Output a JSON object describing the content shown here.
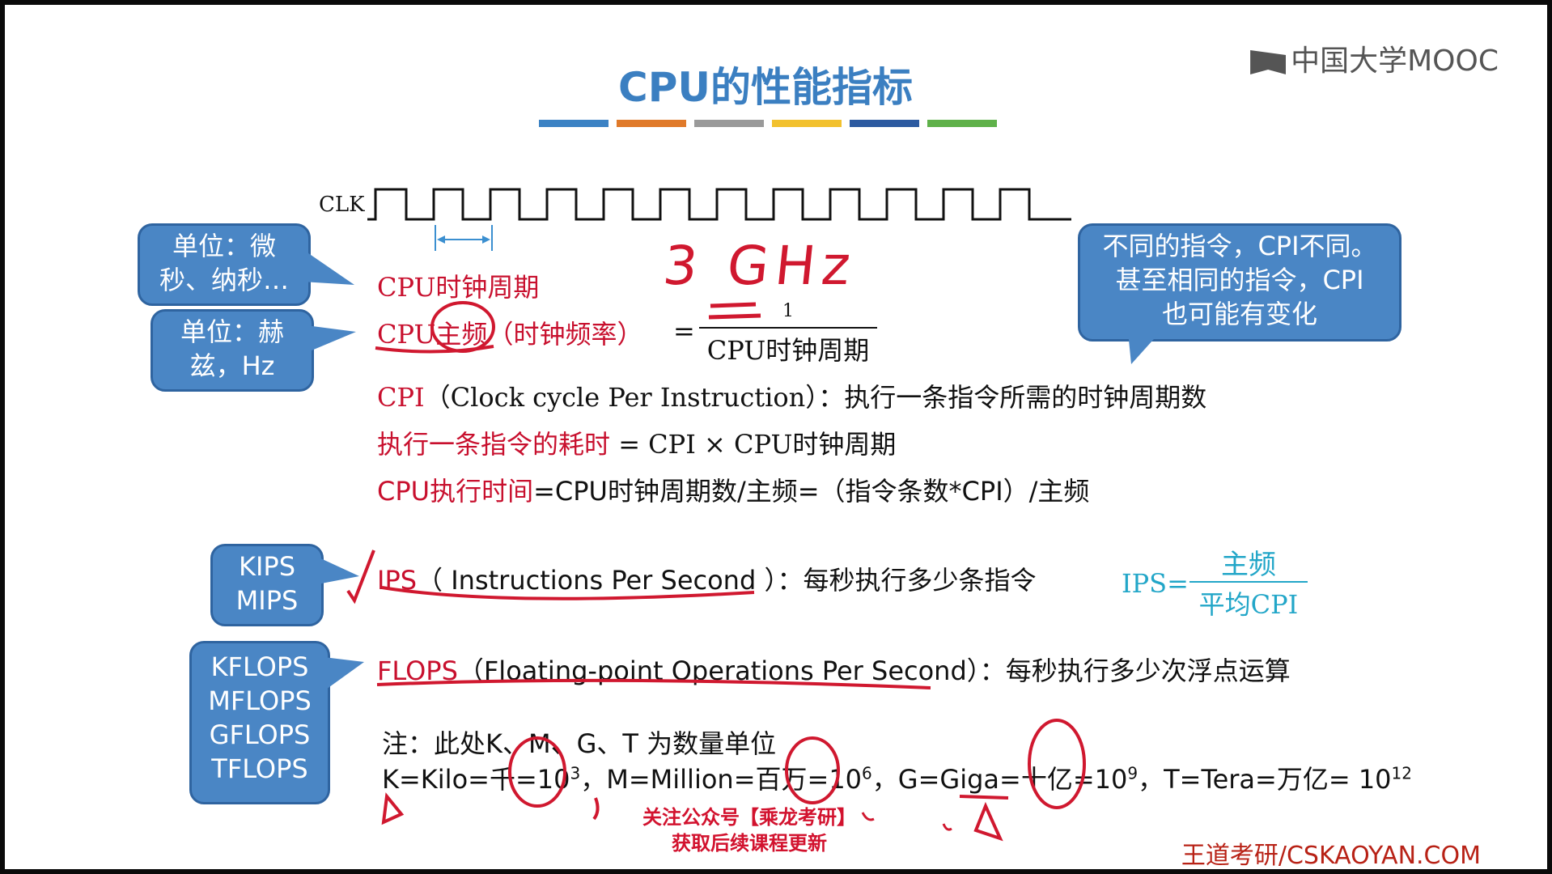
{
  "slide": {
    "title": "CPU的性能指标",
    "logo_text": "中国大学MOOC",
    "color_bars": [
      "#3b82c4",
      "#e07a2a",
      "#9a9a9a",
      "#f2c12e",
      "#2c5aa0",
      "#5fb14a"
    ],
    "clk_label": "CLK",
    "handwritten_freq": "3 GHz",
    "bubbles": {
      "unit_time": [
        "单位：微",
        "秒、纳秒…"
      ],
      "unit_freq": [
        "单位：赫",
        "兹，Hz"
      ],
      "cpi_note": [
        "不同的指令，CPI不同。",
        "甚至相同的指令，CPI",
        "也可能有变化"
      ],
      "ips_units": [
        "KIPS",
        "MIPS"
      ],
      "flops_units": [
        "KFLOPS",
        "MFLOPS",
        "GFLOPS",
        "TFLOPS"
      ]
    },
    "clock_period": "CPU时钟周期",
    "main_freq": {
      "label_red": "CPU主频",
      "label_paren": "（时钟频率）",
      "eq": "=",
      "numerator": "1",
      "denominator": "CPU时钟周期"
    },
    "cpi": {
      "label": "CPI",
      "rest": "（Clock cycle Per Instruction）：执行一条指令所需的时钟周期数"
    },
    "exec_one": {
      "label": "执行一条指令的耗时",
      "rest": " = CPI × CPU时钟周期"
    },
    "exec_time": {
      "label": "CPU执行时间",
      "rest": "=CPU时钟周期数/主频=（指令条数*CPI）/主频"
    },
    "ips": {
      "label": "IPS",
      "rest": "（ Instructions Per Second ）：每秒执行多少条指令",
      "formula_left": "IPS=",
      "formula_num": "主频",
      "formula_den": "平均CPI"
    },
    "flops": {
      "label": "FLOPS",
      "rest": "（Floating-point Operations Per Second）：每秒执行多少次浮点运算"
    },
    "note": {
      "line1": "注：此处K、M、G、T 为数量单位",
      "k": "K=Kilo=千=10",
      "k_exp": "3",
      "m": "，M=Million=百万=10",
      "m_exp": "6",
      "g": "，G=Giga=十亿=10",
      "g_exp": "9",
      "t": "，T=Tera=万亿= 10",
      "t_exp": "12"
    },
    "promo": [
      "关注公众号【乘龙考研】",
      "获取后续课程更新"
    ],
    "footer": "王道考研/CSKAOYAN.COM"
  }
}
